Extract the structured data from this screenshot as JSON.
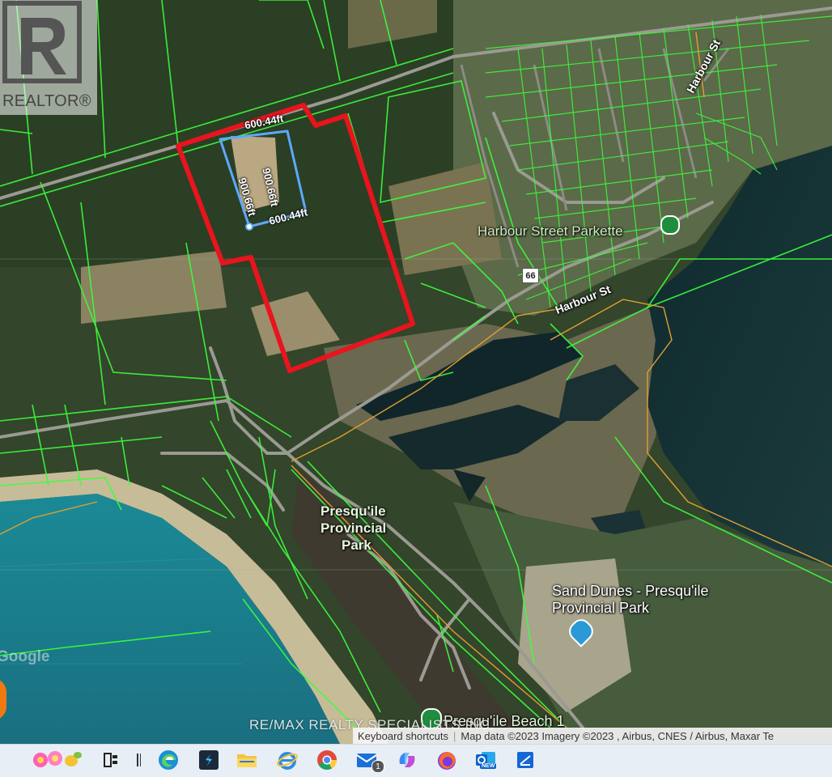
{
  "map": {
    "labels": {
      "harbour_parkette": "Harbour Street Parkette",
      "harbour_st_1": "Harbour St",
      "harbour_st_2": "Harbour St",
      "provincial_park_1": "Presqu'ile",
      "provincial_park_2": "Provincial",
      "provincial_park_3": "Park",
      "sand_dunes_1": "Sand Dunes - Presqu'ile",
      "sand_dunes_2": "Provincial Park",
      "beach": "Presqu'ile Beach 1",
      "road_shield": "66"
    },
    "measurements": {
      "top": "600.44ft",
      "right": "900.66ft",
      "bottom": "600.44ft",
      "left": "900.66ft"
    },
    "google_logo": "Google",
    "brand": "REALTOR",
    "watermark": "RE/MAX REALTY SPECIALISTS INC.",
    "attribution": {
      "shortcuts": "Keyboard shortcuts",
      "map_data": "Map data ©2023 Imagery ©2023 , Airbus, CNES / Airbus, Maxar Te"
    },
    "colors": {
      "parcel_lines": "#3cff3c",
      "property_outline": "#e8141e",
      "measure_line": "#5ea8ff",
      "boundary": "#e0a030",
      "water": "#1d8c98"
    }
  },
  "taskbar": {
    "icons": [
      "flower-widget-icon",
      "task-view-icon",
      "divider-icon",
      "edge-icon",
      "app-s-icon",
      "file-explorer-icon",
      "internet-explorer-icon",
      "chrome-icon",
      "mail-icon",
      "copilot-icon",
      "firefox-icon",
      "outlook-icon",
      "snipping-tool-icon"
    ],
    "mail_badge": "1",
    "outlook_badge": "NEW"
  }
}
